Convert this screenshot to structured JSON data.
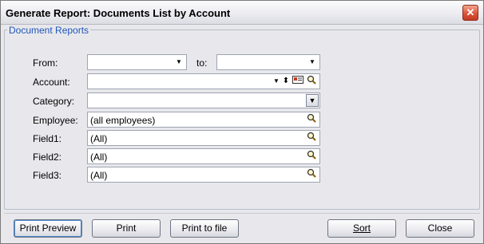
{
  "window": {
    "title": "Generate Report:  Documents List by Account",
    "close_glyph": "✕"
  },
  "group": {
    "title": "Document Reports"
  },
  "form": {
    "from_label": "From:",
    "from_value": "",
    "to_label": "to:",
    "to_value": "",
    "account_label": "Account:",
    "account_value": "",
    "category_label": "Category:",
    "category_value": "",
    "employee_label": "Employee:",
    "employee_value": "(all employees)",
    "field1_label": "Field1:",
    "field1_value": "(All)",
    "field2_label": "Field2:",
    "field2_value": "(All)",
    "field3_label": "Field3:",
    "field3_value": "(All)"
  },
  "icons": {
    "dropdown": "▼",
    "sort_updown": "⬍",
    "card": "card-icon",
    "magnifier": "magnifier-icon"
  },
  "buttons": {
    "print_preview": "Print Preview",
    "print": "Print",
    "print_to_file": "Print to file",
    "sort": "Sort",
    "close": "Close"
  }
}
